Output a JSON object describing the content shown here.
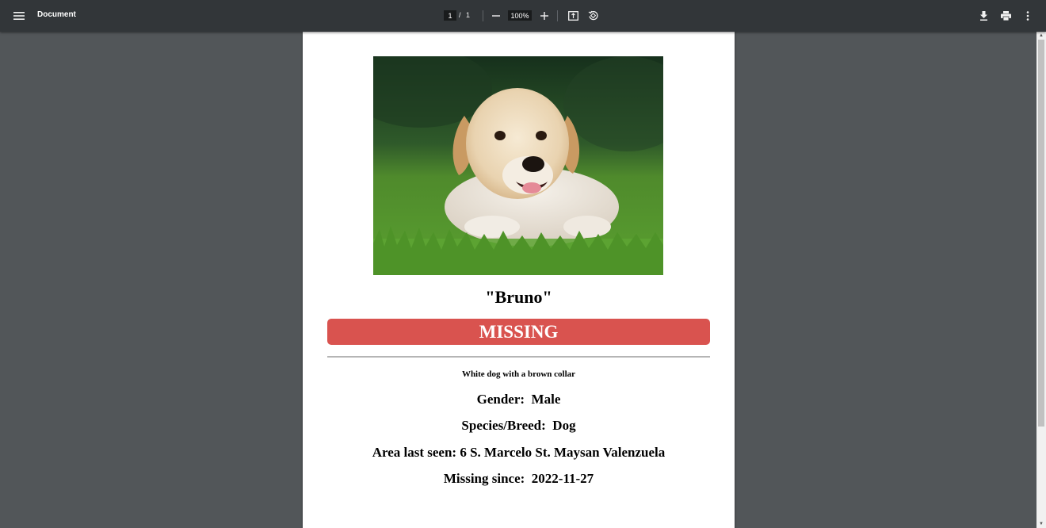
{
  "toolbar": {
    "title": "Document",
    "current_page": "1",
    "page_separator": "/",
    "total_pages": "1",
    "zoom": "100%",
    "icons": [
      "menu-icon",
      "zoom-out-icon",
      "zoom-in-icon",
      "fit-to-page-icon",
      "rotate-icon",
      "download-icon",
      "print-icon",
      "more-vert-icon"
    ]
  },
  "document": {
    "pet_name": "\"Bruno\"",
    "status": "MISSING",
    "status_color": "#d9534f",
    "description": "White dog with a brown collar",
    "gender": "Gender:  Male",
    "species": "Species/Breed:  Dog",
    "area": "Area last seen: 6 S. Marcelo St. Maysan Valenzuela",
    "since": "Missing since:  2022-11-27"
  }
}
